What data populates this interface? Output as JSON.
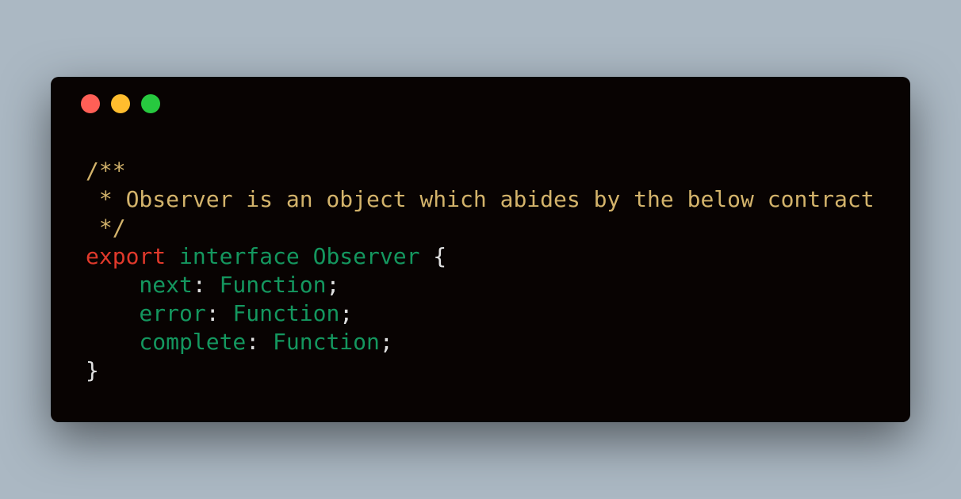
{
  "colors": {
    "background": "#abb8c3",
    "window": "#080302",
    "close": "#ff5f56",
    "minimize": "#ffbd2e",
    "maximize": "#27c93f",
    "comment": "#d3b36b",
    "keyword": "#e0392b",
    "identifier": "#14975f",
    "punctuation": "#e0e0e0"
  },
  "window_controls": [
    {
      "name": "close",
      "color": "#ff5f56"
    },
    {
      "name": "minimize",
      "color": "#ffbd2e"
    },
    {
      "name": "maximize",
      "color": "#27c93f"
    }
  ],
  "code": {
    "language": "typescript",
    "lines": [
      [
        {
          "text": "/**",
          "kind": "comment"
        }
      ],
      [
        {
          "text": " * Observer is an object which abides by the below contract",
          "kind": "comment"
        }
      ],
      [
        {
          "text": " */",
          "kind": "comment"
        }
      ],
      [
        {
          "text": "export",
          "kind": "keyword"
        },
        {
          "text": " ",
          "kind": "punctuation"
        },
        {
          "text": "interface",
          "kind": "identifier"
        },
        {
          "text": " ",
          "kind": "punctuation"
        },
        {
          "text": "Observer",
          "kind": "identifier"
        },
        {
          "text": " {",
          "kind": "punctuation"
        }
      ],
      [
        {
          "text": "    next",
          "kind": "identifier"
        },
        {
          "text": ": ",
          "kind": "punctuation"
        },
        {
          "text": "Function",
          "kind": "identifier"
        },
        {
          "text": ";",
          "kind": "punctuation"
        }
      ],
      [
        {
          "text": "    error",
          "kind": "identifier"
        },
        {
          "text": ": ",
          "kind": "punctuation"
        },
        {
          "text": "Function",
          "kind": "identifier"
        },
        {
          "text": ";",
          "kind": "punctuation"
        }
      ],
      [
        {
          "text": "    complete",
          "kind": "identifier"
        },
        {
          "text": ": ",
          "kind": "punctuation"
        },
        {
          "text": "Function",
          "kind": "identifier"
        },
        {
          "text": ";",
          "kind": "punctuation"
        }
      ],
      [
        {
          "text": "}",
          "kind": "punctuation"
        }
      ]
    ]
  }
}
